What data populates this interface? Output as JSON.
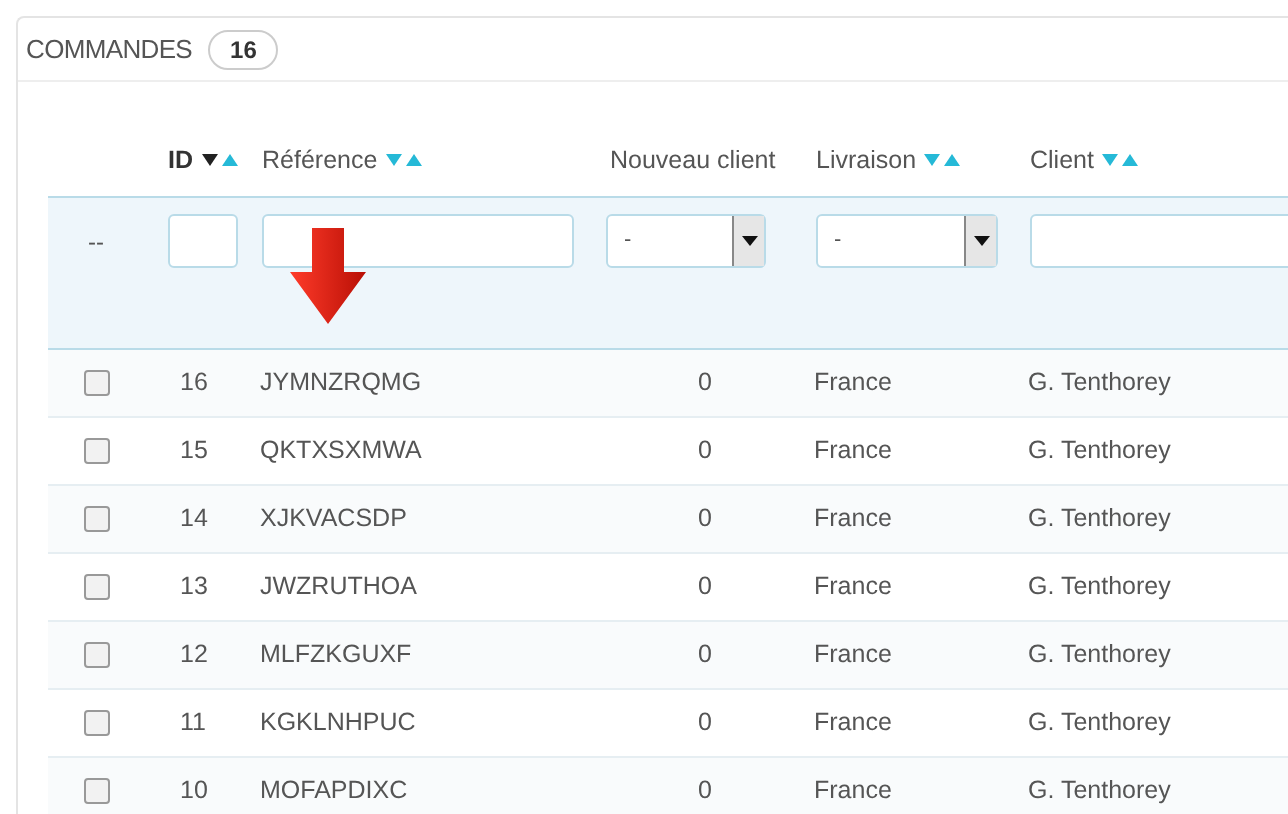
{
  "panel": {
    "title": "COMMANDES",
    "count": "16"
  },
  "columns": [
    {
      "label": "ID",
      "sortable": true,
      "sorted": true
    },
    {
      "label": "Référence",
      "sortable": true,
      "sorted": false
    },
    {
      "label": "Nouveau client",
      "sortable": false,
      "sorted": false
    },
    {
      "label": "Livraison",
      "sortable": true,
      "sorted": false
    },
    {
      "label": "Client",
      "sortable": true,
      "sorted": false
    }
  ],
  "filters": {
    "reset": "--",
    "fields": [
      {
        "kind": "input"
      },
      {
        "kind": "input"
      },
      {
        "kind": "select",
        "value": "-"
      },
      {
        "kind": "select",
        "value": "-"
      },
      {
        "kind": "input"
      }
    ]
  },
  "rows": [
    {
      "checked": false,
      "id": "16",
      "reference": "JYMNZRQMG",
      "new_client": "0",
      "delivery": "France",
      "client": "G. Tenthorey"
    },
    {
      "checked": false,
      "id": "15",
      "reference": "QKTXSXMWA",
      "new_client": "0",
      "delivery": "France",
      "client": "G. Tenthorey"
    },
    {
      "checked": false,
      "id": "14",
      "reference": "XJKVACSDP",
      "new_client": "0",
      "delivery": "France",
      "client": "G. Tenthorey"
    },
    {
      "checked": false,
      "id": "13",
      "reference": "JWZRUTHOA",
      "new_client": "0",
      "delivery": "France",
      "client": "G. Tenthorey"
    },
    {
      "checked": false,
      "id": "12",
      "reference": "MLFZKGUXF",
      "new_client": "0",
      "delivery": "France",
      "client": "G. Tenthorey"
    },
    {
      "checked": false,
      "id": "11",
      "reference": "KGKLNHPUC",
      "new_client": "0",
      "delivery": "France",
      "client": "G. Tenthorey"
    },
    {
      "checked": false,
      "id": "10",
      "reference": "MOFAPDIXC",
      "new_client": "0",
      "delivery": "France",
      "client": "G. Tenthorey"
    }
  ]
}
